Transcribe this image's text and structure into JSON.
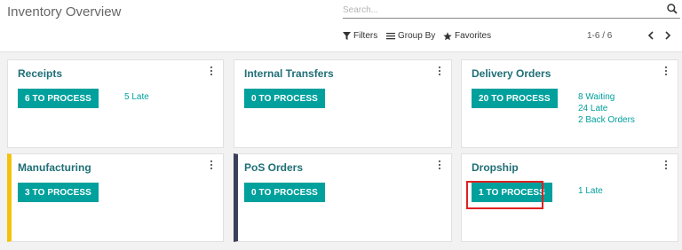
{
  "header": {
    "title": "Inventory Overview",
    "search_placeholder": "Search...",
    "filters_label": "Filters",
    "group_by_label": "Group By",
    "favorites_label": "Favorites",
    "pager_text": "1-6 / 6"
  },
  "cards": [
    {
      "title": "Receipts",
      "button": "6 TO PROCESS",
      "stats": [
        "5 Late"
      ]
    },
    {
      "title": "Internal Transfers",
      "button": "0 TO PROCESS",
      "stats": []
    },
    {
      "title": "Delivery Orders",
      "button": "20 TO PROCESS",
      "stats": [
        "8 Waiting",
        "24 Late",
        "2 Back Orders"
      ]
    },
    {
      "title": "Manufacturing",
      "button": "3 TO PROCESS",
      "stats": [],
      "accent": "#f4c20d"
    },
    {
      "title": "PoS Orders",
      "button": "0 TO PROCESS",
      "stats": [],
      "accent": "#3a3f5c"
    },
    {
      "title": "Dropship",
      "button": "1 TO PROCESS",
      "stats": [
        "1 Late"
      ]
    }
  ],
  "colors": {
    "brand_teal": "#00a09d",
    "title_teal": "#1f6f76",
    "highlight_red": "#e02020"
  },
  "icons": [
    "search-icon",
    "filter-icon",
    "group-by-icon",
    "star-icon",
    "chevron-left-icon",
    "chevron-right-icon",
    "kebab-menu-icon"
  ]
}
